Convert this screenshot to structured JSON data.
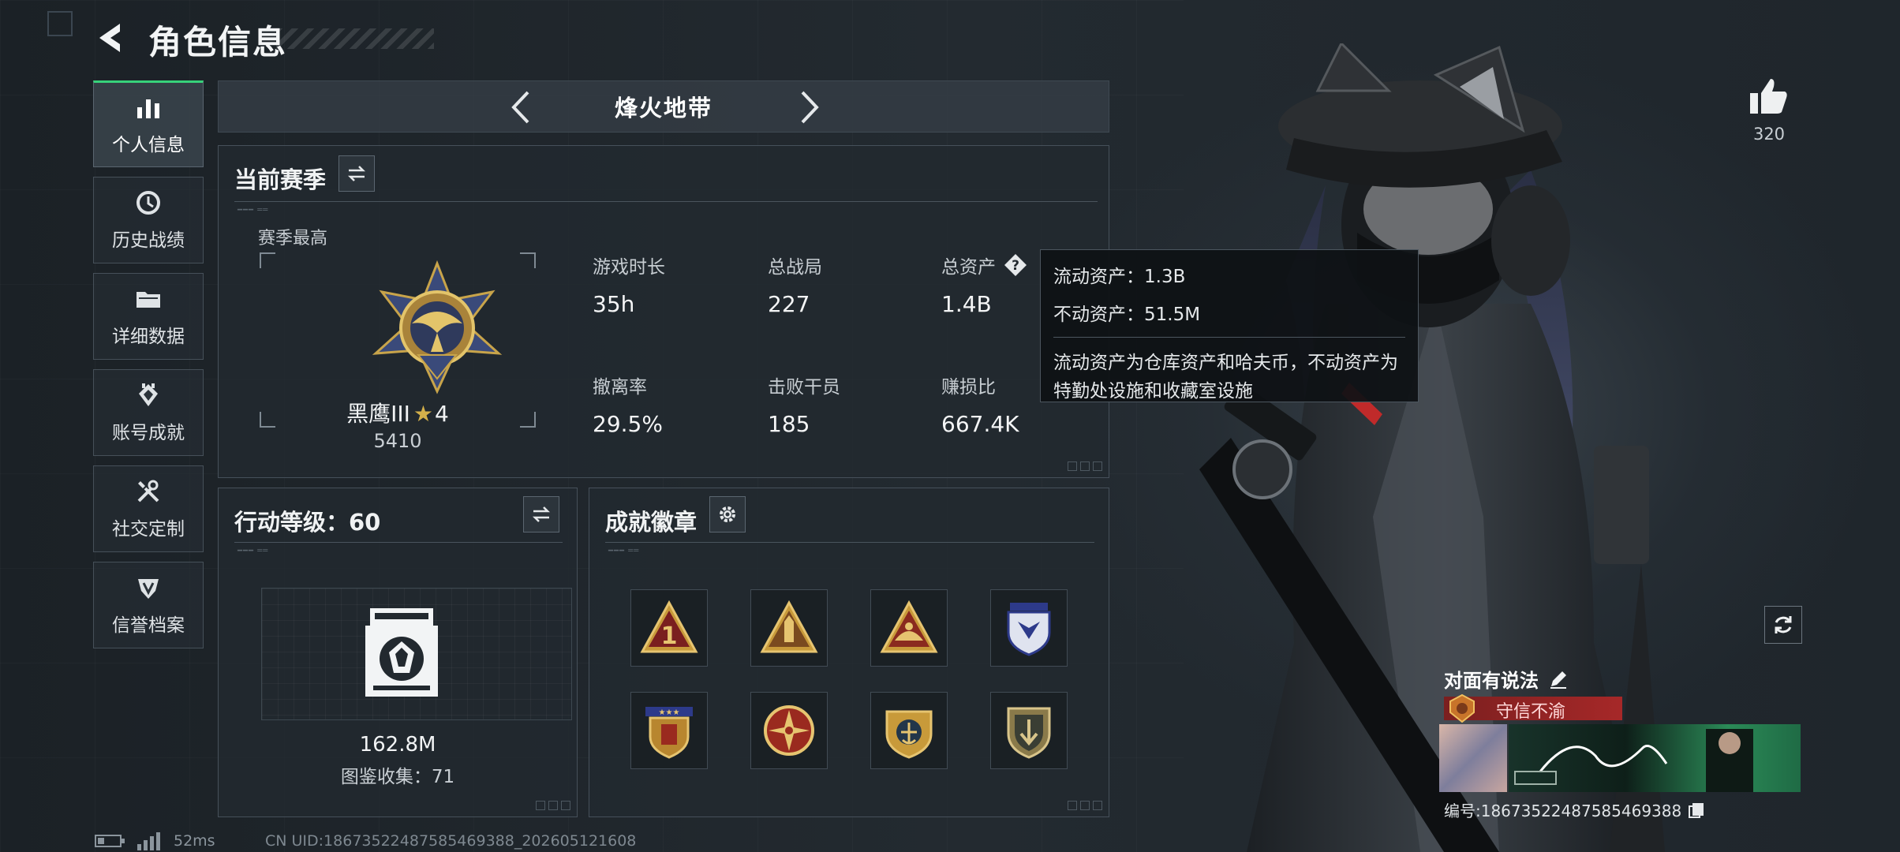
{
  "header": {
    "title": "角色信息"
  },
  "sidebar": {
    "items": [
      {
        "label": "个人信息",
        "icon": "bar-chart-icon",
        "active": true
      },
      {
        "label": "历史战绩",
        "icon": "clock-history-icon",
        "active": false
      },
      {
        "label": "详细数据",
        "icon": "folder-icon",
        "active": false
      },
      {
        "label": "账号成就",
        "icon": "achievement-icon",
        "active": false
      },
      {
        "label": "社交定制",
        "icon": "tools-icon",
        "active": false
      },
      {
        "label": "信誉档案",
        "icon": "reputation-shield-icon",
        "active": false
      }
    ]
  },
  "mode": {
    "title": "烽火地带"
  },
  "season": {
    "title": "当前赛季",
    "subtitle": "赛季最高",
    "rank_name": "黑鹰III",
    "rank_stars": "4",
    "rank_score": "5410",
    "stats": [
      {
        "label": "游戏时长",
        "value": "35h"
      },
      {
        "label": "总战局",
        "value": "227"
      },
      {
        "label": "总资产",
        "value": "1.4B"
      },
      {
        "label": "撤离率",
        "value": "29.5%"
      },
      {
        "label": "击败干员",
        "value": "185"
      },
      {
        "label": "赚损比",
        "value": "667.4K"
      }
    ]
  },
  "tooltip": {
    "liquid": "流动资产：1.3B",
    "fixed": "不动资产：51.5M",
    "description": "流动资产为仓库资产和哈夫币，不动资产为特勤处设施和收藏室设施"
  },
  "level": {
    "title": "行动等级：60",
    "value": "162.8M",
    "collection": "图鉴收集：71"
  },
  "badges": {
    "title": "成就徽章",
    "items": [
      "badge-1-triangle-icon",
      "badge-ammo-triangle-icon",
      "badge-hand-triangle-icon",
      "badge-shield-blue-icon",
      "badge-star-shield-icon",
      "badge-compass-icon",
      "badge-anchor-icon",
      "badge-arrow-shield-icon"
    ]
  },
  "social": {
    "likes": "320",
    "card_title": "对面有说法",
    "banner_text": "守信不渝",
    "id_text": "编号:18673522487585469388"
  },
  "footer": {
    "ping": "52ms",
    "uid": "CN UID:18673522487585469388_202605121608"
  },
  "colors": {
    "accent_green": "#37d27a",
    "banner_red": "#a62828",
    "gold": "#d4b04a"
  }
}
